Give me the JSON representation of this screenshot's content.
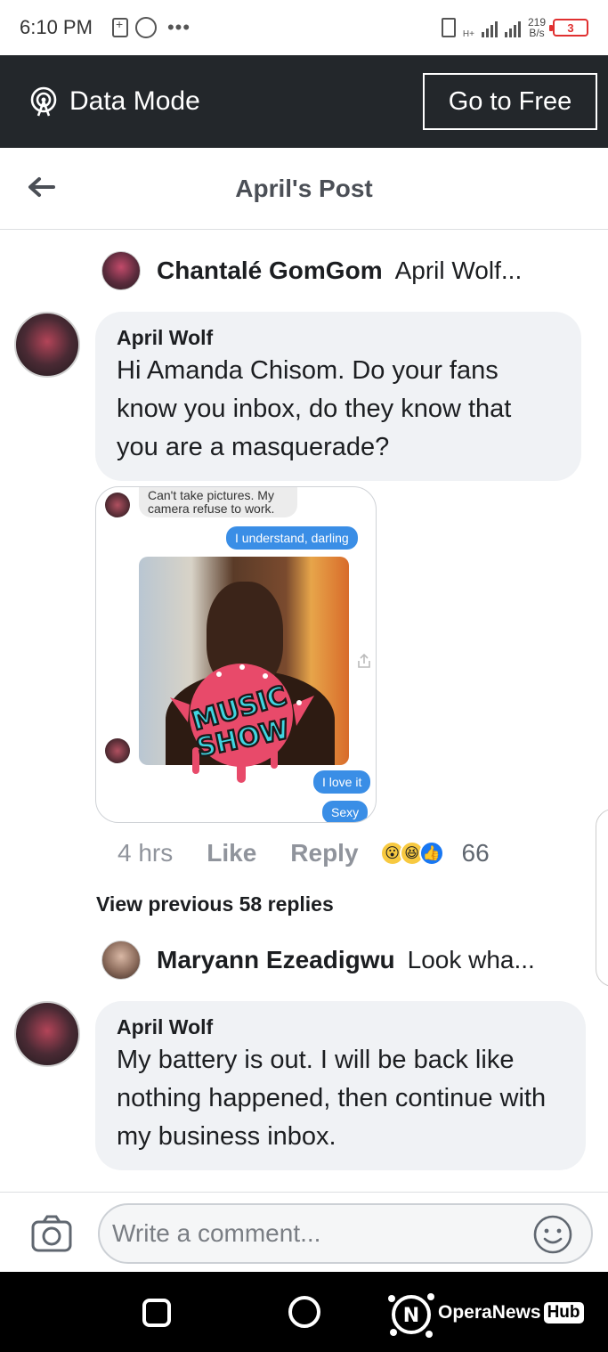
{
  "status_bar": {
    "time": "6:10 PM",
    "dots": "•••",
    "net_speed_value": "219",
    "net_speed_unit": "B/s",
    "battery_level": "3",
    "network_type": "H+"
  },
  "data_mode_bar": {
    "label": "Data Mode",
    "go_free_label": "Go to Free"
  },
  "header": {
    "title": "April's Post"
  },
  "thread_1": {
    "parent_name": "Chantalé GomGom",
    "parent_snippet": "April Wolf...",
    "reply_author": "April Wolf",
    "reply_text": "Hi Amanda Chisom.  Do your fans know you inbox,  do they know that you are a masquerade?",
    "attachment": {
      "msg_top": "Can't take pictures. My camera refuse to work.",
      "msg_understand": "I understand, darling",
      "msg_love": "I love it",
      "msg_sexy": "Sexy",
      "badge_text_top": "MUSIC",
      "badge_text_bottom": "SHOW"
    },
    "meta": {
      "time": "4 hrs",
      "like_label": "Like",
      "reply_label": "Reply",
      "reaction_count": "66"
    }
  },
  "view_previous_label": "View previous 58 replies",
  "thread_2": {
    "parent_name": "Maryann Ezeadigwu",
    "parent_snippet": "Look wha...",
    "reply_author": "April Wolf",
    "reply_text": "My battery is out.  I will be back like nothing happened,  then continue with my business inbox."
  },
  "composer": {
    "placeholder": "Write a comment..."
  },
  "watermark": {
    "brand": "OperaNews",
    "hub": "Hub"
  },
  "colors": {
    "data_mode_bg": "#23272b",
    "bubble_bg": "#f0f2f5",
    "meta_gray": "#90949c",
    "messenger_blue": "#3a8ee6",
    "like_blue": "#1877f2",
    "badge_pink": "#e84a6a",
    "badge_cyan": "#3fd4e0"
  }
}
